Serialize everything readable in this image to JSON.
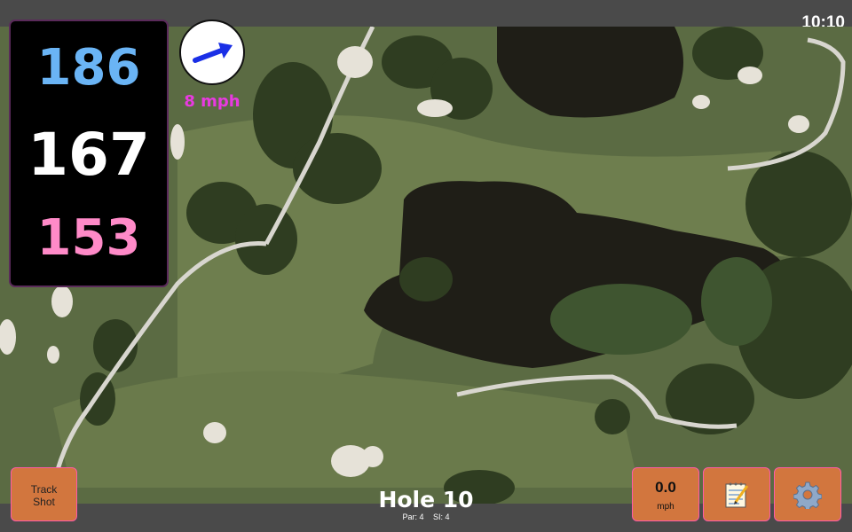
{
  "status": {
    "time": "10:10"
  },
  "yardages": {
    "back": "186",
    "middle": "167",
    "front": "153",
    "back_color": "#6ab4f5",
    "middle_color": "#ffffff",
    "front_color": "#ff8ac8"
  },
  "wind": {
    "speed_text": "8 mph",
    "icon": "wind-arrow-icon",
    "arrow_color": "#1a2fe6",
    "text_color": "#e83ae0"
  },
  "buttons": {
    "track_line1": "Track",
    "track_line2": "Shot",
    "speed_value": "0.0",
    "speed_unit": "mph",
    "notes_icon": "notepad-icon",
    "settings_icon": "gear-icon",
    "fill_color": "#d2763e",
    "border_color": "#ff5aa8"
  },
  "hole": {
    "title": "Hole 10",
    "par": "Par: 4",
    "si": "SI: 4"
  }
}
